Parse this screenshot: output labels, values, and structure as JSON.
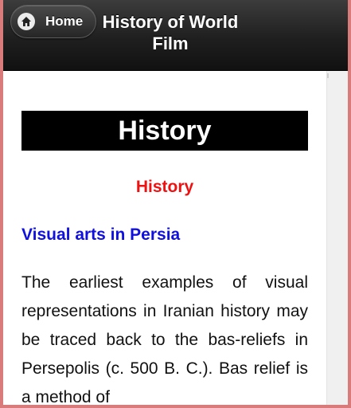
{
  "header": {
    "home_label": "Home",
    "title": "History of World Film"
  },
  "content": {
    "banner": "History",
    "subheading": "History",
    "section_title": "Visual arts in Persia",
    "paragraph": "The earliest examples of visual representations in Iranian history may be traced back to the bas-reliefs in Persepolis (c. 500 B. C.). Bas relief is a method of"
  },
  "icons": {
    "home": "home-icon"
  },
  "colors": {
    "subheading": "#ee1111",
    "section_title": "#1111dd",
    "banner_bg": "#000000",
    "border": "#d97b7b"
  }
}
